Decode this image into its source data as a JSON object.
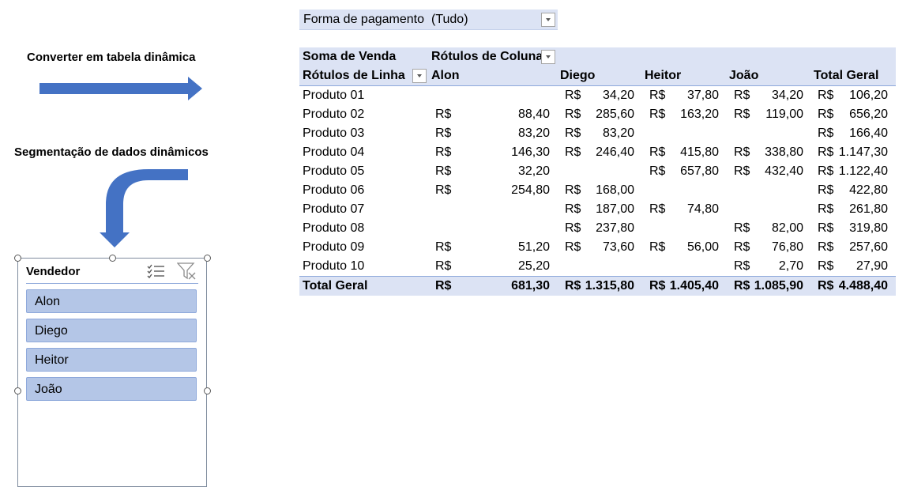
{
  "annotations": {
    "convert_label": "Converter em tabela dinâmica",
    "slicer_label": "Segmentação de dados dinâmicos"
  },
  "filter": {
    "name": "Forma de pagamento",
    "value": "(Tudo)"
  },
  "pivot": {
    "values_label": "Soma de Venda",
    "col_labels": "Rótulos de Coluna",
    "row_labels": "Rótulos de Linha",
    "columns": [
      "Alon",
      "Diego",
      "Heitor",
      "João",
      "Total Geral"
    ],
    "currency": "R$",
    "rows": [
      {
        "name": "Produto 01",
        "v": [
          "",
          "34,20",
          "37,80",
          "34,20",
          "106,20"
        ]
      },
      {
        "name": "Produto 02",
        "v": [
          "88,40",
          "285,60",
          "163,20",
          "119,00",
          "656,20"
        ]
      },
      {
        "name": "Produto 03",
        "v": [
          "83,20",
          "83,20",
          "",
          "",
          "166,40"
        ]
      },
      {
        "name": "Produto 04",
        "v": [
          "146,30",
          "246,40",
          "415,80",
          "338,80",
          "1.147,30"
        ]
      },
      {
        "name": "Produto 05",
        "v": [
          "32,20",
          "",
          "657,80",
          "432,40",
          "1.122,40"
        ]
      },
      {
        "name": "Produto 06",
        "v": [
          "254,80",
          "168,00",
          "",
          "",
          "422,80"
        ]
      },
      {
        "name": "Produto 07",
        "v": [
          "",
          "187,00",
          "74,80",
          "",
          "261,80"
        ]
      },
      {
        "name": "Produto 08",
        "v": [
          "",
          "237,80",
          "",
          "82,00",
          "319,80"
        ]
      },
      {
        "name": "Produto 09",
        "v": [
          "51,20",
          "73,60",
          "56,00",
          "76,80",
          "257,60"
        ]
      },
      {
        "name": "Produto 10",
        "v": [
          "25,20",
          "",
          "",
          "2,70",
          "27,90"
        ]
      }
    ],
    "total": {
      "name": "Total Geral",
      "v": [
        "681,30",
        "1.315,80",
        "1.405,40",
        "1.085,90",
        "4.488,40"
      ]
    }
  },
  "slicer": {
    "title": "Vendedor",
    "items": [
      "Alon",
      "Diego",
      "Heitor",
      "João"
    ]
  },
  "colors": {
    "header_bg": "#dce3f4",
    "slicer_item": "#b4c6e7",
    "arrow": "#4472c4"
  }
}
